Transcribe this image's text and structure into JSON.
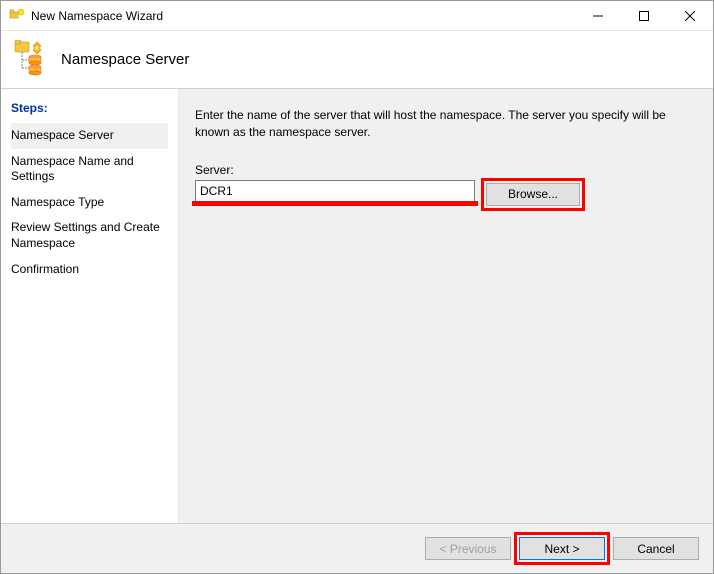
{
  "window": {
    "title": "New Namespace Wizard"
  },
  "header": {
    "title": "Namespace Server"
  },
  "sidebar": {
    "heading": "Steps:",
    "items": [
      {
        "label": "Namespace Server"
      },
      {
        "label": "Namespace Name and Settings"
      },
      {
        "label": "Namespace Type"
      },
      {
        "label": "Review Settings and Create Namespace"
      },
      {
        "label": "Confirmation"
      }
    ]
  },
  "main": {
    "instruction": "Enter the name of the server that will host the namespace. The server you specify will be known as the namespace server.",
    "server_label": "Server:",
    "server_value": "DCR1",
    "browse_label": "Browse..."
  },
  "footer": {
    "previous_label": "< Previous",
    "next_label": "Next >",
    "cancel_label": "Cancel"
  }
}
